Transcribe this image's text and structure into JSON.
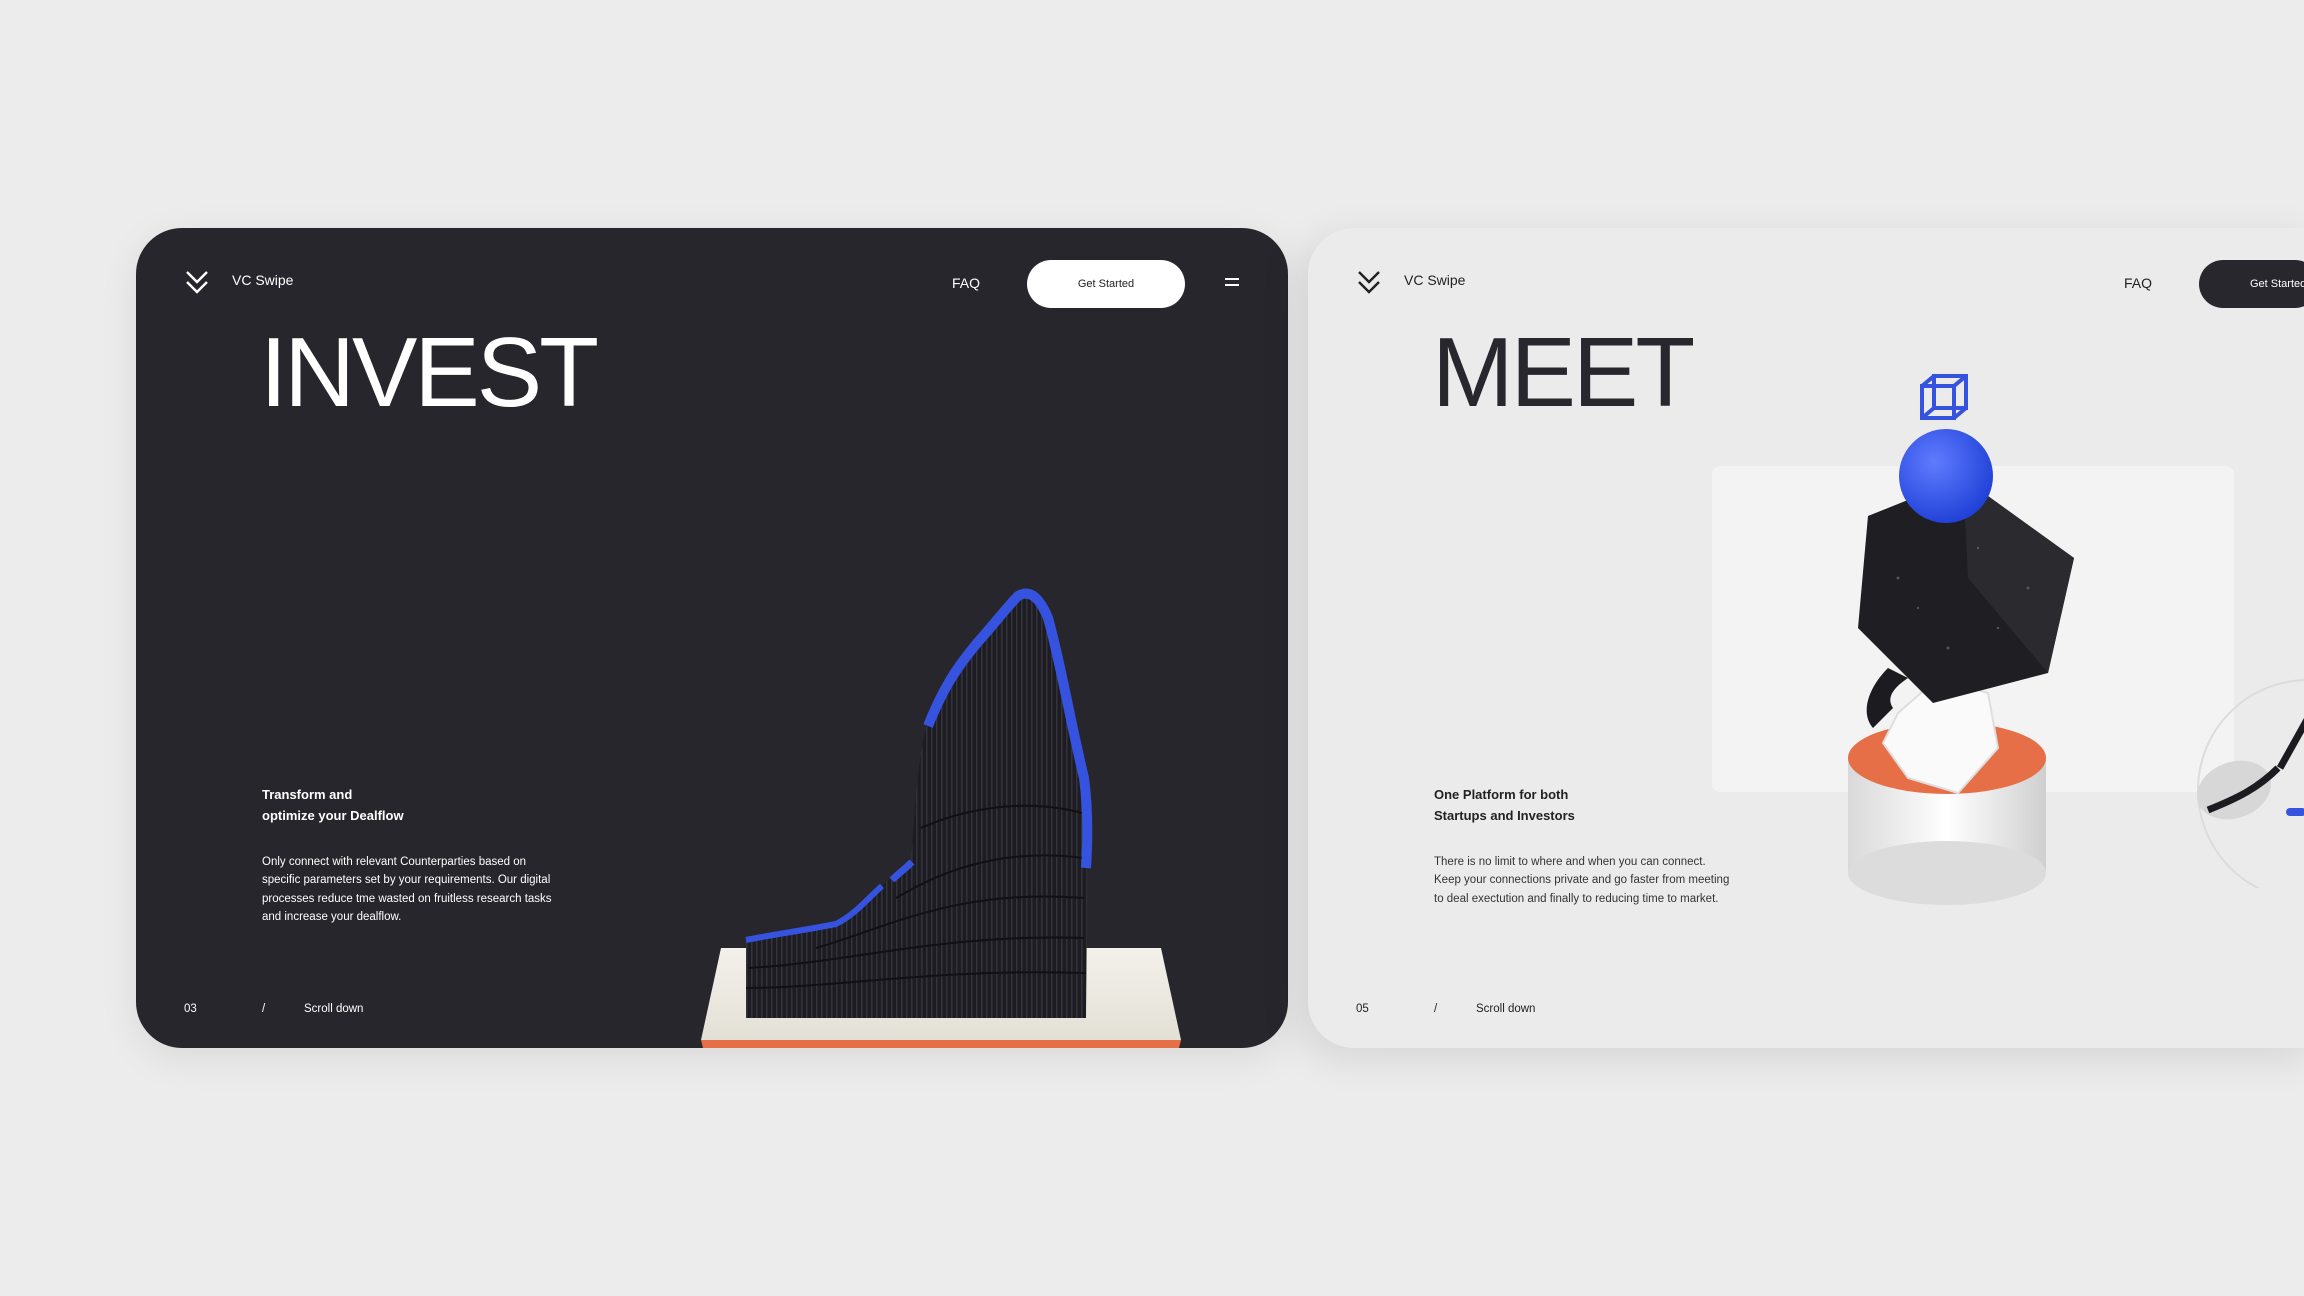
{
  "colors": {
    "dark_card": "#27262c",
    "light_card": "#ebebeb",
    "accent_blue": "#3653e0",
    "accent_orange": "#e66f48",
    "page_bg": "#ececec"
  },
  "cards": [
    {
      "brand": "VC Swipe",
      "logo_icon": "double-chevron-down-icon",
      "nav": {
        "faq": "FAQ",
        "cta": "Get Started",
        "menu_icon": "hamburger-menu-icon"
      },
      "hero": "INVEST",
      "subhead": [
        "Transform and",
        "optimize your Dealflow"
      ],
      "description": "Only connect with relevant Counterparties based on specific parameters set by your requirements. Our digital processes reduce tme wasted on fruitless research tasks and increase your dealflow.",
      "pager": {
        "page": "03",
        "sep": "/",
        "label": "Scroll down"
      }
    },
    {
      "brand": "VC Swipe",
      "logo_icon": "double-chevron-down-icon",
      "nav": {
        "faq": "FAQ",
        "cta": "Get Started"
      },
      "hero": "MEET",
      "subhead": [
        "One Platform for both",
        "Startups and Investors"
      ],
      "description": "There is no limit to where and when you can connect. Keep your connections private and go faster from meeting to deal exectution and finally to reducing time to market.",
      "pager": {
        "page": "05",
        "sep": "/",
        "label": "Scroll down"
      }
    }
  ]
}
